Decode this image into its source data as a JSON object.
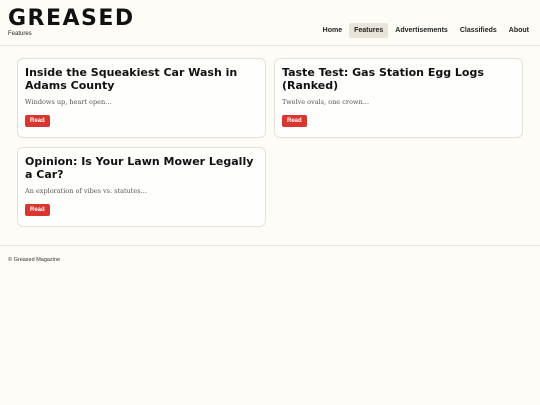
{
  "header": {
    "brand": "GREASED",
    "section": "Features",
    "nav": [
      "Home",
      "Features",
      "Advertisements",
      "Classifieds",
      "About"
    ],
    "active_nav": "Features"
  },
  "cards": [
    {
      "title": "Inside the Squeakiest Car Wash in Adams County",
      "desc": "Windows up, heart open…",
      "button": "Read"
    },
    {
      "title": "Taste Test: Gas Station Egg Logs (Ranked)",
      "desc": "Twelve ovals, one crown…",
      "button": "Read"
    },
    {
      "title": "Opinion: Is Your Lawn Mower Legally a Car?",
      "desc": "An exploration of vibes vs. statutes…",
      "button": "Read"
    }
  ],
  "footer": {
    "text": "© Greased Magazine"
  },
  "colors": {
    "accent": "#d8362f",
    "background": "#fdfcf7",
    "nav_active": "#e8e4da"
  }
}
